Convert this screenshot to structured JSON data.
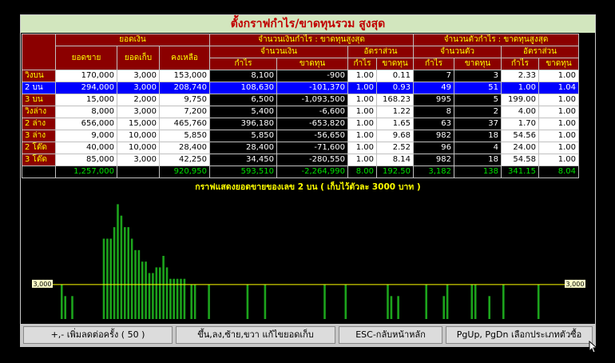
{
  "title": "ตั้งกราฟกำไร/ขาดทุนรวม สูงสุด",
  "headers": {
    "money": "ยอดเงิน",
    "sales": "ยอดขาย",
    "collected": "ยอดเก็บ",
    "remaining": "คงเหลือ",
    "max_money_group": "จำนวนเงินกำไร : ขาดทุนสูงสุด",
    "max_count_group": "จำนวนตัวกำไร : ขาดทุนสูงสุด",
    "amount": "จำนวนเงิน",
    "ratio": "อัตราส่วน",
    "count": "จำนวนตัว",
    "profit": "กำไร",
    "loss": "ขาดทุน"
  },
  "rows": [
    {
      "label": "วิ่งบน",
      "sales": "170,000",
      "collected": "3,000",
      "remaining": "153,000",
      "profit": "8,100",
      "loss": "-900",
      "r_profit": "1.00",
      "r_loss": "0.11",
      "c_profit": "7",
      "c_loss": "3",
      "cr_profit": "2.33",
      "cr_loss": "1.00"
    },
    {
      "label": "2 บน",
      "sales": "294,000",
      "collected": "3,000",
      "remaining": "208,740",
      "profit": "108,630",
      "loss": "-101,370",
      "r_profit": "1.00",
      "r_loss": "0.93",
      "c_profit": "49",
      "c_loss": "51",
      "cr_profit": "1.00",
      "cr_loss": "1.04"
    },
    {
      "label": "3 บน",
      "sales": "15,000",
      "collected": "2,000",
      "remaining": "9,750",
      "profit": "6,500",
      "loss": "-1,093,500",
      "r_profit": "1.00",
      "r_loss": "168.23",
      "c_profit": "995",
      "c_loss": "5",
      "cr_profit": "199.00",
      "cr_loss": "1.00"
    },
    {
      "label": "วิ่งล่าง",
      "sales": "8,000",
      "collected": "3,000",
      "remaining": "7,200",
      "profit": "5,400",
      "loss": "-6,600",
      "r_profit": "1.00",
      "r_loss": "1.22",
      "c_profit": "8",
      "c_loss": "2",
      "cr_profit": "4.00",
      "cr_loss": "1.00"
    },
    {
      "label": "2 ล่าง",
      "sales": "656,000",
      "collected": "15,000",
      "remaining": "465,760",
      "profit": "396,180",
      "loss": "-653,820",
      "r_profit": "1.00",
      "r_loss": "1.65",
      "c_profit": "63",
      "c_loss": "37",
      "cr_profit": "1.70",
      "cr_loss": "1.00"
    },
    {
      "label": "3 ล่าง",
      "sales": "9,000",
      "collected": "10,000",
      "remaining": "5,850",
      "profit": "5,850",
      "loss": "-56,650",
      "r_profit": "1.00",
      "r_loss": "9.68",
      "c_profit": "982",
      "c_loss": "18",
      "cr_profit": "54.56",
      "cr_loss": "1.00"
    },
    {
      "label": "2 โต๊ด",
      "sales": "40,000",
      "collected": "10,000",
      "remaining": "28,400",
      "profit": "28,400",
      "loss": "-71,600",
      "r_profit": "1.00",
      "r_loss": "2.52",
      "c_profit": "96",
      "c_loss": "4",
      "cr_profit": "24.00",
      "cr_loss": "1.00"
    },
    {
      "label": "3 โต๊ด",
      "sales": "85,000",
      "collected": "3,000",
      "remaining": "42,250",
      "profit": "34,450",
      "loss": "-280,550",
      "r_profit": "1.00",
      "r_loss": "8.14",
      "c_profit": "982",
      "c_loss": "18",
      "cr_profit": "54.58",
      "cr_loss": "1.00"
    }
  ],
  "selected_row": 1,
  "totals": {
    "sales": "1,257,000",
    "collected": "",
    "remaining": "920,950",
    "profit": "593,510",
    "loss": "-2,264,990",
    "r_profit": "8.00",
    "r_loss": "192.50",
    "c_profit": "3,182",
    "c_loss": "138",
    "cr_profit": "341.15",
    "cr_loss": "8.04"
  },
  "chart_title": "กราฟแสดงยอดขายของเลข 2 บน     ( เก็บไว้ตัวละ 3000 บาท )",
  "chart_data": {
    "type": "bar",
    "threshold": 3000,
    "threshold_left_label": "3,000",
    "threshold_right_label": "3,000",
    "ylim": [
      0,
      11000
    ],
    "values": [
      3000,
      2000,
      0,
      2000,
      0,
      0,
      0,
      0,
      0,
      0,
      0,
      0,
      7000,
      7000,
      7000,
      8000,
      10000,
      9000,
      8000,
      8000,
      7000,
      6000,
      6000,
      5000,
      5000,
      4000,
      4000,
      4500,
      4500,
      5500,
      4500,
      3500,
      3500,
      3500,
      3500,
      3500,
      0,
      3000,
      3000,
      0,
      0,
      0,
      3000,
      0,
      0,
      0,
      0,
      0,
      0,
      0,
      0,
      0,
      0,
      3000,
      0,
      0,
      0,
      0,
      3000,
      0,
      0,
      0,
      0,
      0,
      0,
      0,
      0,
      0,
      0,
      0,
      0,
      0,
      0,
      0,
      0,
      3000,
      0,
      0,
      0,
      0,
      0,
      3000,
      0,
      0,
      0,
      0,
      0,
      0,
      0,
      0,
      0,
      0,
      0,
      3000,
      2000,
      0,
      2000,
      0,
      0,
      0,
      0,
      0,
      0,
      0,
      3000,
      0,
      0,
      0,
      0,
      2000,
      3000,
      0,
      0,
      0,
      0,
      0,
      0,
      3000,
      3000,
      0,
      0,
      0,
      2000,
      0,
      0,
      0,
      3000,
      0,
      0,
      0,
      0,
      0,
      0,
      0,
      0,
      0,
      3000,
      0,
      0,
      0,
      0,
      0,
      0,
      0
    ],
    "bar_color": "#1ca31c",
    "threshold_color": "#ffff00"
  },
  "buttons": [
    "+,- เพิ่มลดต่อครั้ง ( 50 )",
    "ขึ้น,ลง,ซ้าย,ขวา  แก้ไขยอดเก็บ",
    "ESC-กลับหน้าหลัก",
    "PgUp, PgDn เลือกประเภทตัวซื้อ"
  ]
}
